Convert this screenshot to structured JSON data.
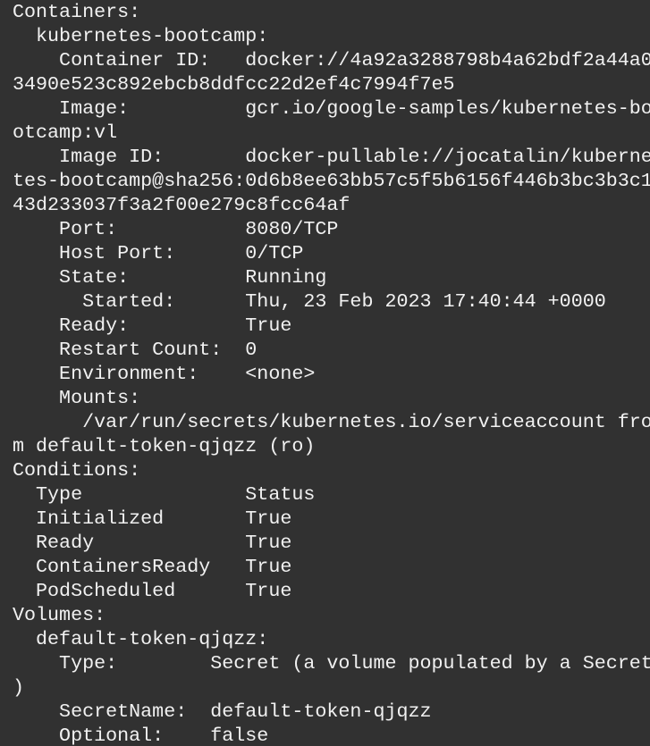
{
  "terminal": {
    "lines": [
      "Containers:",
      "  kubernetes-bootcamp:",
      "    Container ID:   docker://4a92a3288798b4a62bdf2a44a0",
      "3490e523c892ebcb8ddfcc22d2ef4c7994f7e5",
      "    Image:          gcr.io/google-samples/kubernetes-bo",
      "otcamp:vl",
      "    Image ID:       docker-pullable://jocatalin/kuberne",
      "tes-bootcamp@sha256:0d6b8ee63bb57c5f5b6156f446b3bc3b3c1",
      "43d233037f3a2f00e279c8fcc64af",
      "    Port:           8080/TCP",
      "    Host Port:      0/TCP",
      "    State:          Running",
      "      Started:      Thu, 23 Feb 2023 17:40:44 +0000",
      "    Ready:          True",
      "    Restart Count:  0",
      "    Environment:    <none>",
      "    Mounts:",
      "      /var/run/secrets/kubernetes.io/serviceaccount fro",
      "m default-token-qjqzz (ro)",
      "Conditions:",
      "  Type              Status",
      "  Initialized       True",
      "  Ready             True",
      "  ContainersReady   True",
      "  PodScheduled      True",
      "Volumes:",
      "  default-token-qjqzz:",
      "    Type:        Secret (a volume populated by a Secret",
      ")",
      "    SecretName:  default-token-qjqzz",
      "    Optional:    false"
    ]
  }
}
